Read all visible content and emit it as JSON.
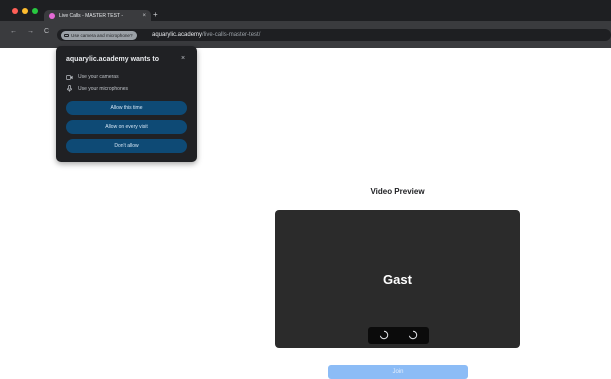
{
  "browser": {
    "window_controls": {
      "close_color": "#ff5f57",
      "minimize_color": "#febc2e",
      "maximize_color": "#28c840"
    },
    "tab": {
      "title": "Live Calls - MASTER TEST - ",
      "close": "×",
      "favicon_color": "#e56ad6"
    },
    "new_tab": "+",
    "nav": {
      "back": "←",
      "forward": "→",
      "reload": "C"
    },
    "permission_chip": "Use camera and microphone?",
    "url": {
      "host": "aquarylic.academy",
      "path": "/live-calls-master-test/"
    }
  },
  "permission_popup": {
    "title": "aquarylic.academy wants to",
    "close": "×",
    "permissions": [
      {
        "icon": "camera-icon",
        "label": "Use your cameras"
      },
      {
        "icon": "microphone-icon",
        "label": "Use your microphones"
      }
    ],
    "buttons": {
      "allow_once": "Allow this time",
      "allow_always": "Allow on every visit",
      "deny": "Don't allow"
    }
  },
  "page": {
    "title": "Video Preview",
    "video_name": "Gast",
    "join_button": "Join",
    "colors": {
      "video_bg": "#2b2b2b",
      "join_bg": "#8cbcf6",
      "popup_button": "#0e4a75"
    }
  }
}
